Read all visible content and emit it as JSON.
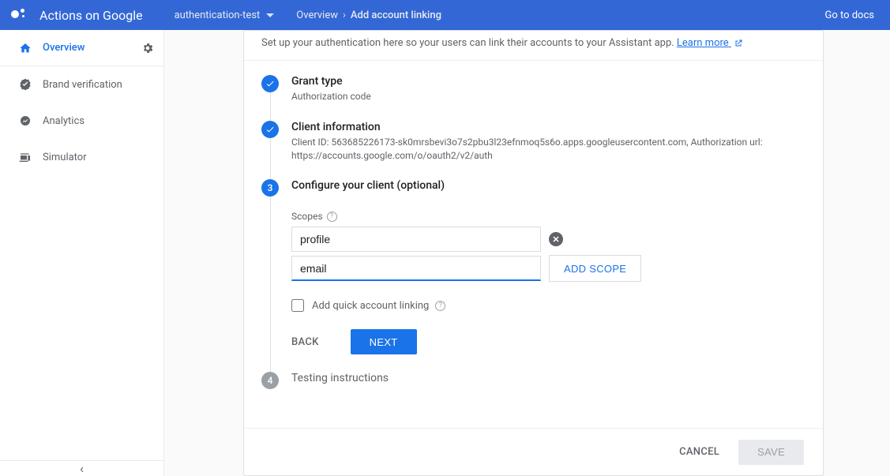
{
  "header": {
    "product": "Actions on Google",
    "project": "authentication-test",
    "breadcrumb_overview": "Overview",
    "breadcrumb_current": "Add account linking",
    "docs_link": "Go to docs"
  },
  "sidebar": {
    "overview": "Overview",
    "brand_verification": "Brand verification",
    "analytics": "Analytics",
    "simulator": "Simulator"
  },
  "intro": {
    "text": "Set up your authentication here so your users can link their accounts to your Assistant app. ",
    "learn_more": "Learn more"
  },
  "steps": {
    "grant_type": {
      "title": "Grant type",
      "subtitle": "Authorization code"
    },
    "client_info": {
      "title": "Client information",
      "subtitle": "Client ID: 563685226173-sk0mrsbevi3o7s2pbu3l23efnmoq5s6o.apps.googleusercontent.com, Authorization url: https://accounts.google.com/o/oauth2/v2/auth"
    },
    "configure": {
      "title": "Configure your client (optional)",
      "scopes_label": "Scopes",
      "scope_values": {
        "0": "profile",
        "1": "email"
      },
      "add_scope": "ADD SCOPE",
      "quick_link": "Add quick account linking",
      "back": "BACK",
      "next": "NEXT"
    },
    "testing": {
      "number": "4",
      "title": "Testing instructions"
    }
  },
  "footer": {
    "cancel": "CANCEL",
    "save": "SAVE"
  }
}
